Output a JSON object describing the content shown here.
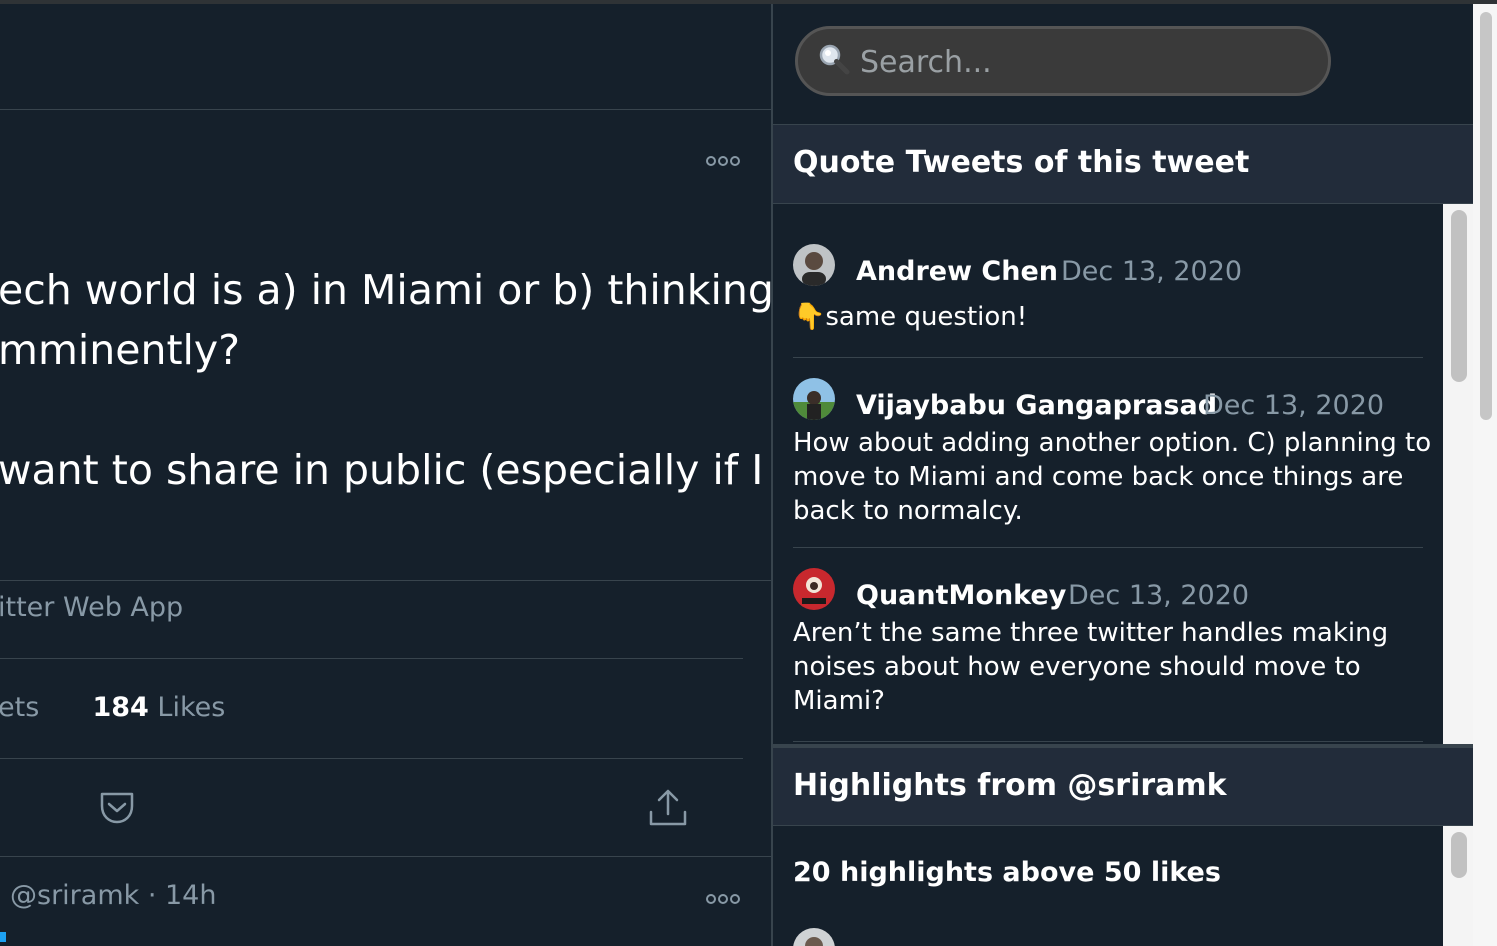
{
  "tweet": {
    "more_label": "ooo",
    "lines": [
      "ech world is a) in Miami or b) thinking",
      "mminently?",
      "want to share in public (especially if I"
    ],
    "source": "itter Web App",
    "retweets_tail": "ets",
    "likes_count": "184",
    "likes_label": "Likes"
  },
  "reply": {
    "handle_time": "@sriramk · 14h",
    "more_label": "ooo"
  },
  "sidebar": {
    "search": {
      "placeholder": "Search..."
    },
    "quote_tweets": {
      "title": "Quote Tweets of this tweet",
      "items": [
        {
          "author": "Andrew Chen",
          "date": "Dec 13, 2020",
          "text": "👇same question!"
        },
        {
          "author": "Vijaybabu Gangaprasad",
          "date": "Dec 13, 2020",
          "text": "How about adding another option. C) planning to move to Miami and come back once things are back to normalcy."
        },
        {
          "author": "QuantMonkey",
          "date": "Dec 13, 2020",
          "text": "Aren’t the same three twitter handles making noises about how everyone should move to Miami?"
        }
      ]
    },
    "highlights": {
      "title": "Highlights from @sriramk",
      "subtitle": "20 highlights above 50 likes"
    }
  },
  "colors": {
    "background": "#15202b",
    "section_header": "#222c3a",
    "muted_text": "#8899a6",
    "divider": "#38444d",
    "link_blue": "#1da1f2"
  }
}
